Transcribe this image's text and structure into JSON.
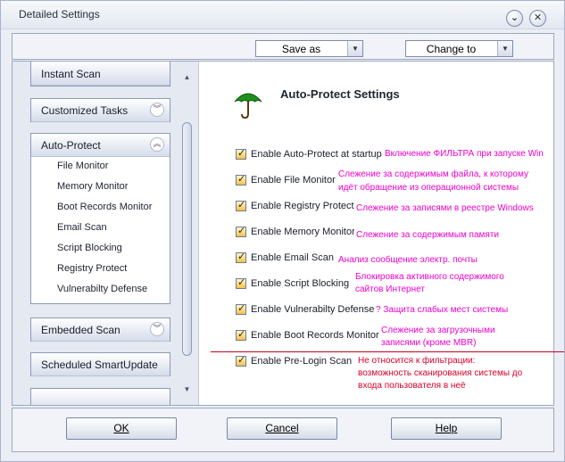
{
  "window": {
    "title": "Detailed Settings"
  },
  "toolbar": {
    "save_as": "Save as",
    "change_to": "Change to"
  },
  "sidebar": {
    "groups": [
      {
        "label": "Instant Scan",
        "chevron": "double-chevron-down"
      },
      {
        "label": "Customized Tasks",
        "chevron": "double-chevron-down"
      },
      {
        "label": "Auto-Protect",
        "chevron": "double-chevron-up",
        "items": [
          "File Monitor",
          "Memory Monitor",
          "Boot Records Monitor",
          "Email Scan",
          "Script Blocking",
          "Registry Protect",
          "Vulnerabilty Defense"
        ]
      },
      {
        "label": "Embedded Scan",
        "chevron": "double-chevron-down"
      },
      {
        "label": "Scheduled SmartUpdate",
        "chevron": ""
      }
    ]
  },
  "main": {
    "heading": "Auto-Protect Settings",
    "options": [
      {
        "label": "Enable Auto-Protect at startup",
        "checked": true,
        "note": "Включение ФИЛЬТРА при запуске Win"
      },
      {
        "label": "Enable File Monitor",
        "checked": true,
        "note1": "Слежение за содержимым файла, к которому",
        "note2": "идёт обращение из операционной системы"
      },
      {
        "label": "Enable Registry Protect",
        "checked": true,
        "note": "Слежение за записями в реестре Windows"
      },
      {
        "label": "Enable Memory Monitor",
        "checked": true,
        "note": "Слежение за содержимым памяти"
      },
      {
        "label": "Enable Email Scan",
        "checked": true,
        "note": "Анализ сообщение электр. почты"
      },
      {
        "label": "Enable Script Blocking",
        "checked": true,
        "note1": "Блокировка активного содержимого",
        "note2": "сайтов Интернет"
      },
      {
        "label": "Enable Vulnerabilty Defense",
        "checked": true,
        "note": "? Защита слабых мест системы"
      },
      {
        "label": "Enable Boot Records Monitor",
        "checked": true,
        "note1": "Слежение за загрузочными",
        "note2": "записями (кроме MBR)"
      },
      {
        "label": "Enable Pre-Login Scan",
        "checked": true,
        "note1": "Не относится к фильтрации:",
        "note2": "возможность сканирования системы до",
        "note3": "входа пользователя в неё"
      }
    ]
  },
  "footer": {
    "ok": "OK",
    "cancel": "Cancel",
    "help": "Help"
  },
  "colors": {
    "note_magenta": "#ee00cc",
    "note_red": "#d9002a",
    "checkbox": "#f3c246",
    "accent": "#1b7a1b"
  }
}
